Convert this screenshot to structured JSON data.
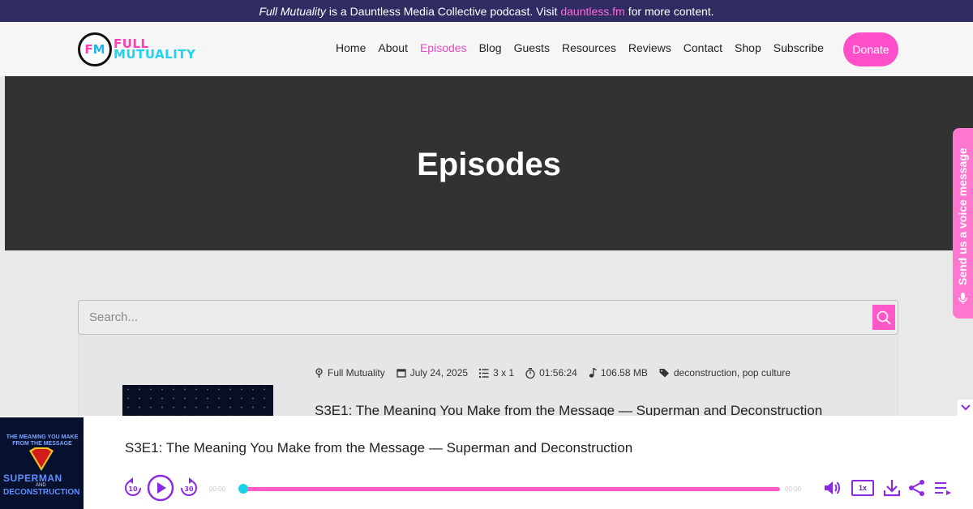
{
  "announcement": {
    "podcast_name": "Full Mutuality",
    "text": "is a Dauntless Media Collective podcast. Visit",
    "link": "dauntless.fm",
    "suffix": "for more content."
  },
  "logo": {
    "mark_f": "F",
    "mark_m": "M",
    "line1": "FULL",
    "line2": "MUTUALITY"
  },
  "nav": {
    "items": [
      "Home",
      "About",
      "Episodes",
      "Blog",
      "Guests",
      "Resources",
      "Reviews",
      "Contact",
      "Shop",
      "Subscribe"
    ],
    "active": "Episodes",
    "donate": "Donate"
  },
  "hero": {
    "title": "Episodes"
  },
  "voice_tab": {
    "label": "Send us a voice message"
  },
  "search": {
    "placeholder": "Search..."
  },
  "episode": {
    "show": "Full Mutuality",
    "date": "July 24, 2025",
    "episode_number": "3 x 1",
    "duration": "01:56:24",
    "size": "106.58 MB",
    "tags": "deconstruction, pop culture",
    "title": "S3E1: The Meaning You Make from the Message — Superman and Deconstruction"
  },
  "player": {
    "title": "S3E1: The Meaning You Make from the Message — Superman and Deconstruction",
    "rewind": "10",
    "forward": "30",
    "time_elapsed": "00:00",
    "time_total": "00:00",
    "progress": 0,
    "speed": "1x",
    "artwork": {
      "top_text": "THE MEANING YOU MAKE FROM THE MESSAGE",
      "hero": "SUPERMAN",
      "and": "AND",
      "bottom": "DECONSTRUCTION"
    }
  },
  "colors": {
    "accent_pink": "#ff4fcb",
    "topbar": "#2e2c63",
    "hero_bg": "#323232",
    "player_purple": "#8a2be2",
    "knob_cyan": "#19d2e8"
  }
}
